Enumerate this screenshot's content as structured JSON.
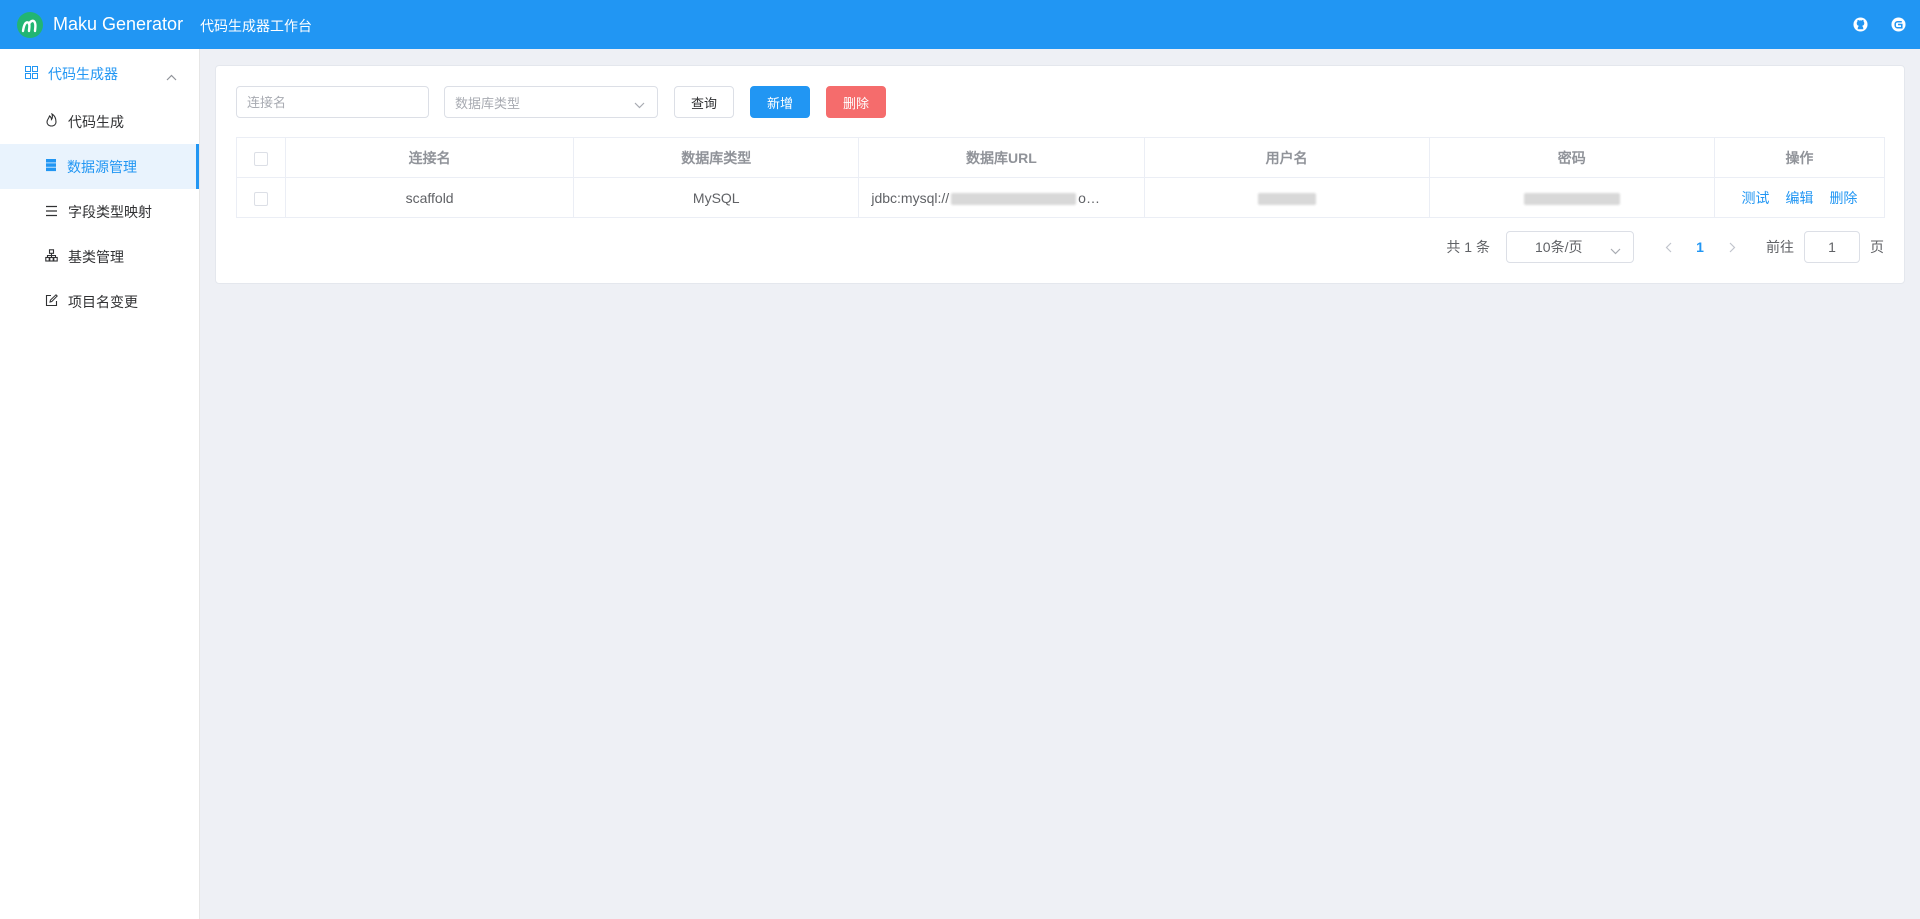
{
  "header": {
    "app_name": "Maku Generator",
    "subtitle": "代码生成器工作台",
    "brand_color": "#2196f3",
    "icons": [
      "github-icon",
      "gitee-icon"
    ]
  },
  "sidebar": {
    "group": {
      "label": "代码生成器",
      "icon": "grid-icon",
      "expanded": true
    },
    "items": [
      {
        "label": "代码生成",
        "icon": "flame-icon",
        "active": false
      },
      {
        "label": "数据源管理",
        "icon": "database-icon",
        "active": true
      },
      {
        "label": "字段类型映射",
        "icon": "list-icon",
        "active": false
      },
      {
        "label": "基类管理",
        "icon": "hierarchy-icon",
        "active": false
      },
      {
        "label": "项目名变更",
        "icon": "edit-icon",
        "active": false
      }
    ]
  },
  "toolbar": {
    "search_placeholder": "连接名",
    "db_type_placeholder": "数据库类型",
    "query_label": "查询",
    "add_label": "新增",
    "delete_label": "删除"
  },
  "table": {
    "columns": [
      "连接名",
      "数据库类型",
      "数据库URL",
      "用户名",
      "密码",
      "操作"
    ],
    "rows": [
      {
        "name": "scaffold",
        "db_type": "MySQL",
        "url_prefix": "jdbc:mysql://",
        "url_suffix": "o…",
        "actions": [
          "测试",
          "编辑",
          "删除"
        ]
      }
    ]
  },
  "pagination": {
    "total_label": "共 1 条",
    "page_size": "10条/页",
    "current_page": "1",
    "goto_label": "前往",
    "goto_value": "1",
    "page_unit": "页"
  }
}
